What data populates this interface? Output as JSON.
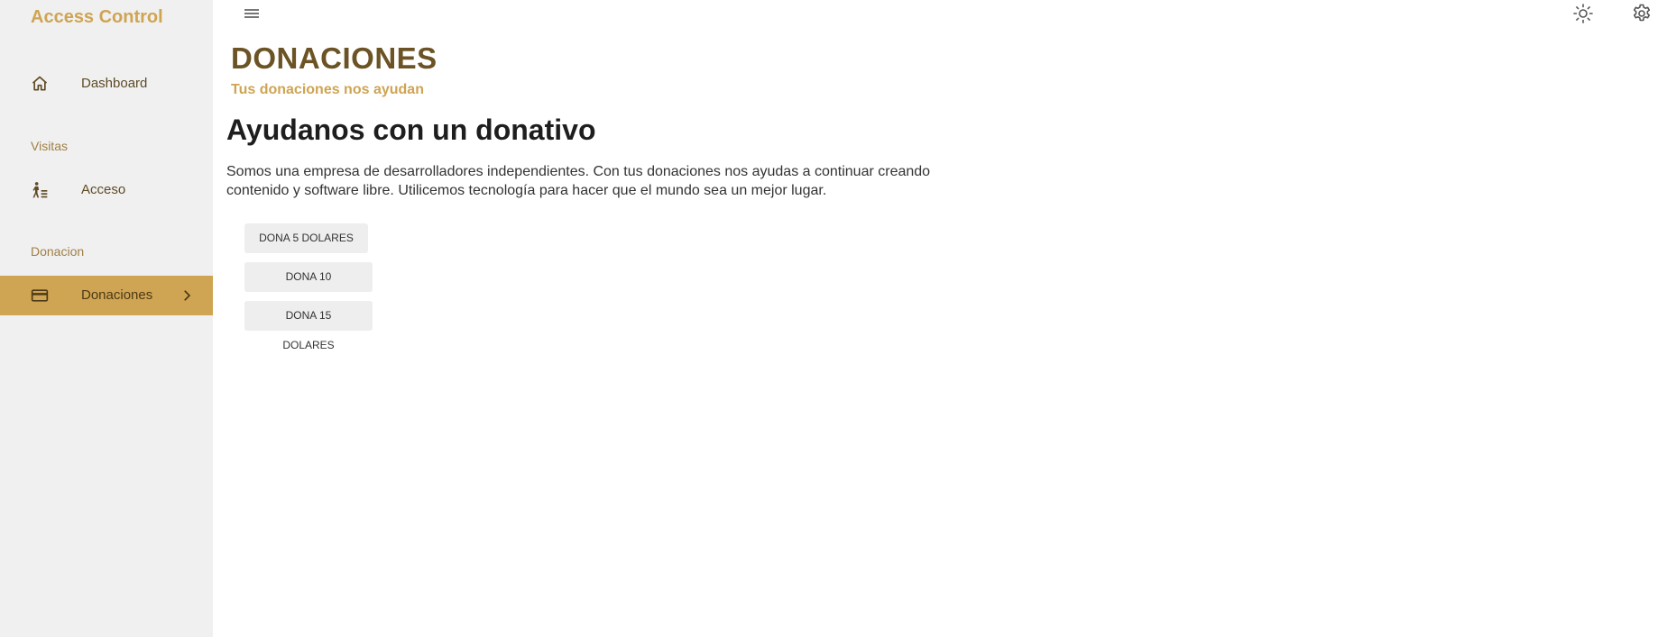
{
  "sidebar": {
    "brand": "Access Control",
    "items": [
      {
        "label": "Dashboard",
        "icon": "home-icon"
      },
      {
        "label": "Acceso",
        "icon": "person-walking-icon"
      },
      {
        "label": "Donaciones",
        "icon": "credit-card-icon",
        "active": true
      }
    ],
    "sections": [
      "Visitas",
      "Donacion"
    ]
  },
  "topbar": {
    "menu_icon": "hamburger-menu-icon",
    "theme_icon": "sun-icon",
    "settings_icon": "gear-icon"
  },
  "main": {
    "title": "DONACIONES",
    "subtitle": "Tus donaciones nos ayudan",
    "heading": "Ayudanos con un donativo",
    "paragraph": "Somos una empresa de desarrolladores independientes. Con tus donaciones nos ayudas a continuar creando contenido y software libre. Utilicemos tecnología para hacer que el mundo sea un mejor lugar.",
    "buttons": [
      "DONA 5 DOLARES",
      "DONA 10 DOLARES",
      "DONA 15 DOLARES"
    ]
  },
  "colors": {
    "accent": "#cfa452",
    "title": "#6b5325",
    "sidebar_bg": "#f0f0f0"
  }
}
